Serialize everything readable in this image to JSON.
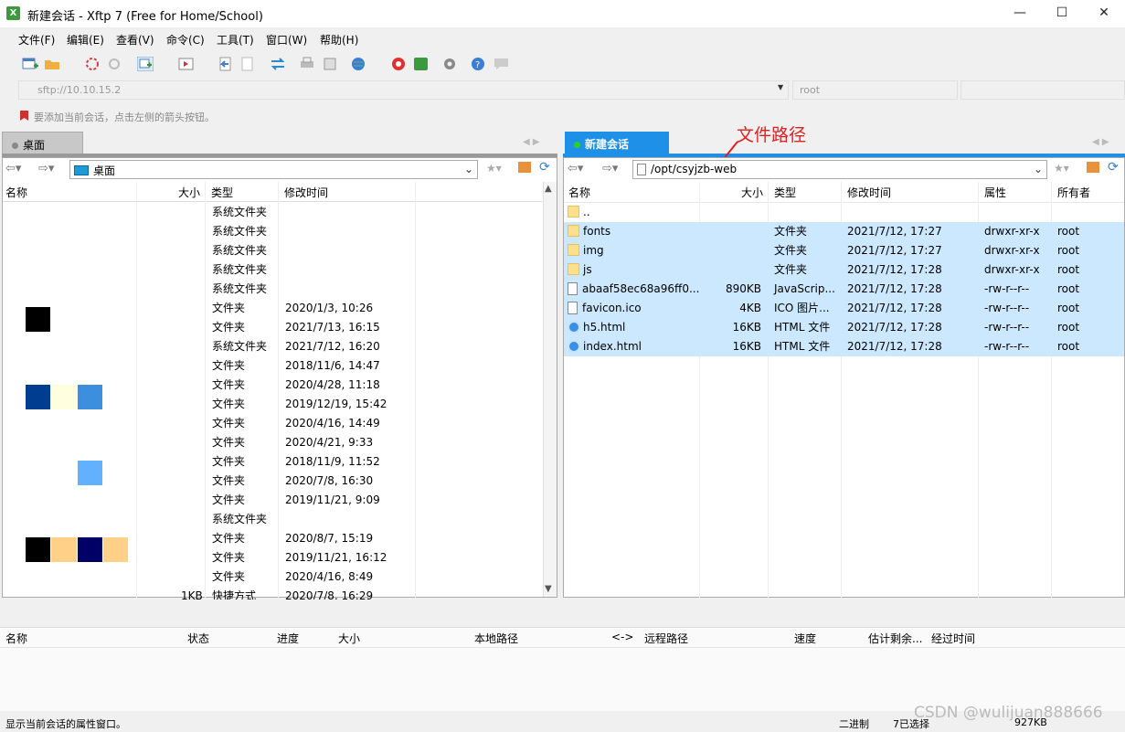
{
  "window": {
    "title": "新建会话 - Xftp 7 (Free for Home/School)",
    "min": "—",
    "max": "☐",
    "close": "✕",
    "app_icon": "X"
  },
  "menu": [
    "文件(F)",
    "编辑(E)",
    "查看(V)",
    "命令(C)",
    "工具(T)",
    "窗口(W)",
    "帮助(H)"
  ],
  "address": {
    "value": "sftp://10.10.15.2",
    "user": "root"
  },
  "hint": "要添加当前会话，点击左侧的箭头按钮。",
  "left": {
    "tab": "桌面",
    "path": "桌面",
    "headers": [
      "名称",
      "大小",
      "类型",
      "修改时间"
    ],
    "rows": [
      [
        "",
        "",
        "系统文件夹",
        ""
      ],
      [
        "",
        "",
        "系统文件夹",
        ""
      ],
      [
        "",
        "",
        "系统文件夹",
        ""
      ],
      [
        "",
        "",
        "系统文件夹",
        ""
      ],
      [
        "",
        "",
        "系统文件夹",
        ""
      ],
      [
        "",
        "",
        "文件夹",
        "2020/1/3, 10:26"
      ],
      [
        "",
        "",
        "文件夹",
        "2021/7/13, 16:15"
      ],
      [
        "",
        "",
        "系统文件夹",
        "2021/7/12, 16:20"
      ],
      [
        "",
        "",
        "文件夹",
        "2018/11/6, 14:47"
      ],
      [
        "",
        "",
        "文件夹",
        "2020/4/28, 11:18"
      ],
      [
        "",
        "",
        "文件夹",
        "2019/12/19, 15:42"
      ],
      [
        "",
        "",
        "文件夹",
        "2020/4/16, 14:49"
      ],
      [
        "",
        "",
        "文件夹",
        "2020/4/21, 9:33"
      ],
      [
        "",
        "",
        "文件夹",
        "2018/11/9, 11:52"
      ],
      [
        "",
        "",
        "文件夹",
        "2020/7/8, 16:30"
      ],
      [
        "",
        "",
        "文件夹",
        "2019/11/21, 9:09"
      ],
      [
        "",
        "",
        "系统文件夹",
        ""
      ],
      [
        "",
        "",
        "文件夹",
        "2020/8/7, 15:19"
      ],
      [
        "",
        "",
        "文件夹",
        "2019/11/21, 16:12"
      ],
      [
        "",
        "",
        "文件夹",
        "2020/4/16, 8:49"
      ],
      [
        "",
        "1KB",
        "快捷方式",
        "2020/7/8, 16:29"
      ]
    ]
  },
  "right": {
    "tab": "新建会话",
    "path": "/opt/csyjzb-web",
    "annotation": "文件路径",
    "headers": [
      "名称",
      "大小",
      "类型",
      "修改时间",
      "属性",
      "所有者"
    ],
    "rows": [
      {
        "name": "..",
        "size": "",
        "type": "",
        "mtime": "",
        "attr": "",
        "owner": "",
        "icon": "folder",
        "sel": false
      },
      {
        "name": "fonts",
        "size": "",
        "type": "文件夹",
        "mtime": "2021/7/12, 17:27",
        "attr": "drwxr-xr-x",
        "owner": "root",
        "icon": "folder",
        "sel": true
      },
      {
        "name": "img",
        "size": "",
        "type": "文件夹",
        "mtime": "2021/7/12, 17:27",
        "attr": "drwxr-xr-x",
        "owner": "root",
        "icon": "folder",
        "sel": true
      },
      {
        "name": "js",
        "size": "",
        "type": "文件夹",
        "mtime": "2021/7/12, 17:28",
        "attr": "drwxr-xr-x",
        "owner": "root",
        "icon": "folder",
        "sel": true
      },
      {
        "name": "abaaf58ec68a96ff0...",
        "size": "890KB",
        "type": "JavaScrip...",
        "mtime": "2021/7/12, 17:28",
        "attr": "-rw-r--r--",
        "owner": "root",
        "icon": "file",
        "sel": true
      },
      {
        "name": "favicon.ico",
        "size": "4KB",
        "type": "ICO 图片...",
        "mtime": "2021/7/12, 17:28",
        "attr": "-rw-r--r--",
        "owner": "root",
        "icon": "file",
        "sel": true
      },
      {
        "name": "h5.html",
        "size": "16KB",
        "type": "HTML 文件",
        "mtime": "2021/7/12, 17:28",
        "attr": "-rw-r--r--",
        "owner": "root",
        "icon": "html",
        "sel": true
      },
      {
        "name": "index.html",
        "size": "16KB",
        "type": "HTML 文件",
        "mtime": "2021/7/12, 17:28",
        "attr": "-rw-r--r--",
        "owner": "root",
        "icon": "html",
        "sel": true
      }
    ]
  },
  "transfer": {
    "headers": [
      "名称",
      "状态",
      "进度",
      "大小",
      "本地路径",
      "<->",
      "远程路径",
      "速度",
      "估计剩余...",
      "经过时间"
    ]
  },
  "status": {
    "left": "显示当前会话的属性窗口。",
    "mode": "二进制",
    "selected": "7已选择",
    "size": "927KB",
    "watermark": "CSDN @wulijuan888666"
  }
}
